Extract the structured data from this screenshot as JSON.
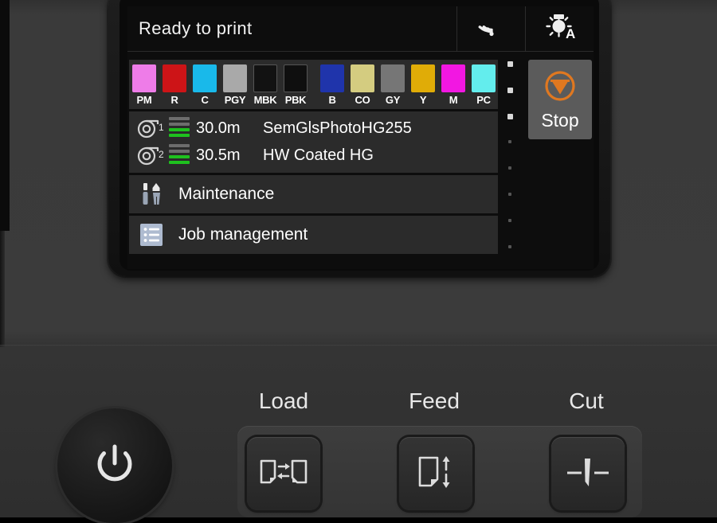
{
  "device": {
    "type": "large-format-printer-control-panel"
  },
  "display": {
    "header": {
      "status_text": "Ready to print",
      "wifi_icon": "wifi-icon",
      "lamp_icon": "lamp-auto-icon",
      "lamp_mode_label": "A"
    },
    "ink_groups": [
      {
        "name": "group-left",
        "inks": [
          {
            "code": "PM",
            "name": "photo-magenta",
            "color": "#ee7ce8"
          },
          {
            "code": "R",
            "name": "red",
            "color": "#cd1417"
          },
          {
            "code": "C",
            "name": "cyan",
            "color": "#19b9ea"
          },
          {
            "code": "PGY",
            "name": "photo-gray",
            "color": "#a9a9a9"
          },
          {
            "code": "MBK",
            "name": "matte-black",
            "color": "#121212"
          },
          {
            "code": "PBK",
            "name": "photo-black",
            "color": "#0f0f0f"
          }
        ]
      },
      {
        "name": "group-right",
        "inks": [
          {
            "code": "B",
            "name": "blue",
            "color": "#1f34ab"
          },
          {
            "code": "CO",
            "name": "chroma-optimizer",
            "color": "#d4cc80"
          },
          {
            "code": "GY",
            "name": "gray",
            "color": "#767676"
          },
          {
            "code": "Y",
            "name": "yellow",
            "color": "#e0ac07"
          },
          {
            "code": "M",
            "name": "magenta",
            "color": "#f217e2"
          },
          {
            "code": "PC",
            "name": "photo-cyan",
            "color": "#63eded"
          }
        ]
      }
    ],
    "media_rolls": [
      {
        "roll_number": "1",
        "length": "30.0m",
        "media_name": "SemGlsPhotoHG255",
        "level_bars": [
          "#6d6d6d",
          "#6d6d6d",
          "#1ec11e",
          "#1ec11e"
        ]
      },
      {
        "roll_number": "2",
        "length": "30.5m",
        "media_name": "HW Coated HG",
        "level_bars": [
          "#6d6d6d",
          "#6d6d6d",
          "#1ec11e",
          "#1ec11e"
        ]
      }
    ],
    "menu_items": [
      {
        "label": "Maintenance",
        "icon": "tools-icon"
      },
      {
        "label": "Job management",
        "icon": "list-icon"
      }
    ],
    "scroll_indicator": {
      "active_dots": 3,
      "dim_dots": 5
    },
    "stop_button": {
      "label": "Stop",
      "icon": "stop-triangle-icon",
      "accent_color": "#e07820",
      "background_color": "#5b5b5b"
    }
  },
  "hardware_controls": {
    "power_button": {
      "name": "power-button",
      "icon": "power-icon"
    },
    "keys": [
      {
        "label": "Load",
        "icon": "paper-load-icon"
      },
      {
        "label": "Feed",
        "icon": "paper-feed-icon"
      },
      {
        "label": "Cut",
        "icon": "paper-cut-icon"
      }
    ]
  }
}
